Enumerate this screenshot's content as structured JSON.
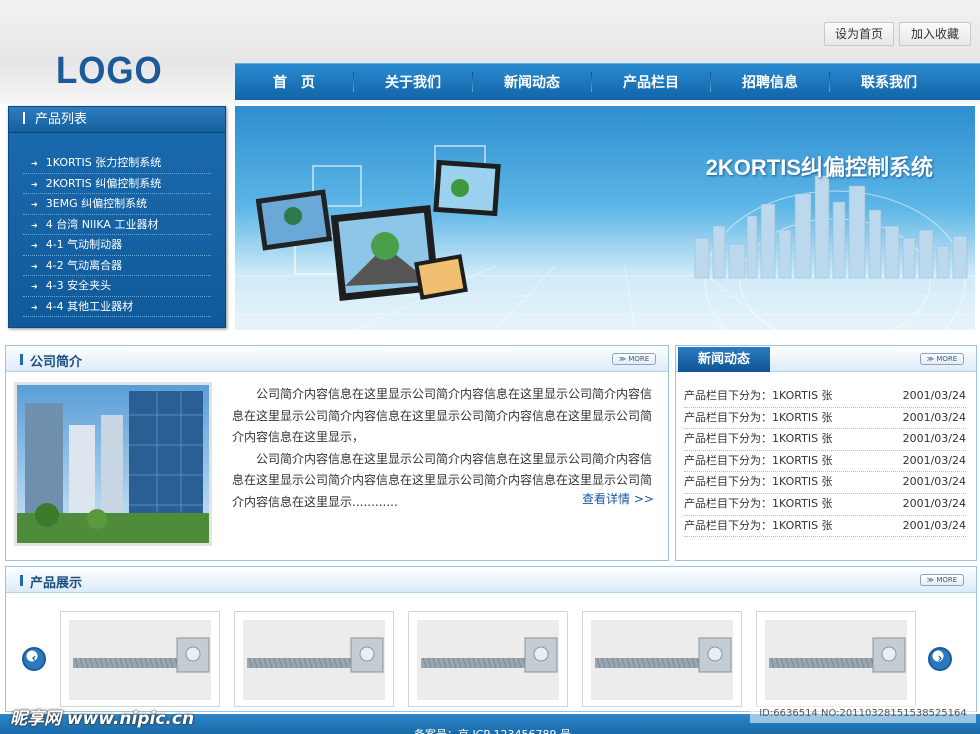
{
  "header": {
    "logo": "LOGO",
    "set_home": "设为首页",
    "add_favorite": "加入收藏"
  },
  "nav": {
    "items": [
      "首　页",
      "关于我们",
      "新闻动态",
      "产品栏目",
      "招聘信息",
      "联系我们"
    ]
  },
  "sidebar": {
    "title": "产品列表",
    "items": [
      "1KORTIS 张力控制系统",
      "2KORTIS 纠偏控制系统",
      "3EMG 纠偏控制系统",
      "4 台湾 NIIKA 工业器材",
      "4-1 气动制动器",
      "4-2 气动离合器",
      "4-3 安全夹头",
      "4-4 其他工业器材"
    ]
  },
  "banner": {
    "title": "2KORTIS纠偏控制系统"
  },
  "intro": {
    "title": "公司简介",
    "more": "MORE",
    "para1": "公司简介内容信息在这里显示公司简介内容信息在这里显示公司简介内容信息在这里显示公司简介内容信息在这里显示公司简介内容信息在这里显示公司简介内容信息在这里显示，",
    "para2": "公司简介内容信息在这里显示公司简介内容信息在这里显示公司简介内容信息在这里显示公司简介内容信息在这里显示公司简介内容信息在这里显示公司简介内容信息在这里显示............",
    "detail": "查看详情 >>"
  },
  "news": {
    "title": "新闻动态",
    "more": "MORE",
    "items": [
      {
        "text": "产品栏目下分为：1KORTIS 张",
        "date": "2001/03/24"
      },
      {
        "text": "产品栏目下分为：1KORTIS 张",
        "date": "2001/03/24"
      },
      {
        "text": "产品栏目下分为：1KORTIS 张",
        "date": "2001/03/24"
      },
      {
        "text": "产品栏目下分为：1KORTIS 张",
        "date": "2001/03/24"
      },
      {
        "text": "产品栏目下分为：1KORTIS 张",
        "date": "2001/03/24"
      },
      {
        "text": "产品栏目下分为：1KORTIS 张",
        "date": "2001/03/24"
      },
      {
        "text": "产品栏目下分为：1KORTIS 张",
        "date": "2001/03/24"
      }
    ]
  },
  "showcase": {
    "title": "产品展示",
    "more": "MORE",
    "prev_icon": "arrow-left-icon",
    "next_icon": "arrow-right-icon"
  },
  "footer": {
    "icp": "备案号：京 ICP 123456789 号"
  },
  "watermark": {
    "logo": "昵享网 www.nipic.cn",
    "id": "ID:6636514 NO:20110328151538525164"
  }
}
